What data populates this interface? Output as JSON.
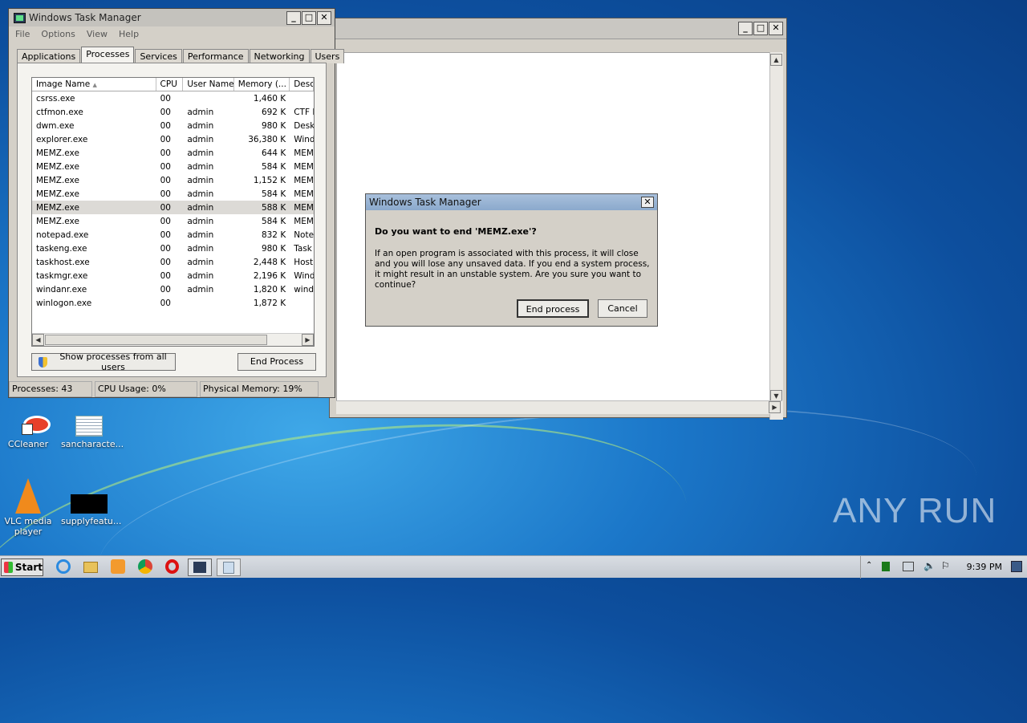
{
  "background_window": {
    "caption_buttons": [
      "_",
      "□",
      "✕"
    ]
  },
  "task_manager": {
    "title": "Windows Task Manager",
    "menu": [
      "File",
      "Options",
      "View",
      "Help"
    ],
    "tabs": [
      "Applications",
      "Processes",
      "Services",
      "Performance",
      "Networking",
      "Users"
    ],
    "active_tab": "Processes",
    "columns": [
      "Image Name",
      "CPU",
      "User Name",
      "Memory (...",
      "Desc"
    ],
    "rows": [
      {
        "name": "csrss.exe",
        "cpu": "00",
        "user": "",
        "mem": "1,460 K",
        "desc": ""
      },
      {
        "name": "ctfmon.exe",
        "cpu": "00",
        "user": "admin",
        "mem": "692 K",
        "desc": "CTF L"
      },
      {
        "name": "dwm.exe",
        "cpu": "00",
        "user": "admin",
        "mem": "980 K",
        "desc": "Desk"
      },
      {
        "name": "explorer.exe",
        "cpu": "00",
        "user": "admin",
        "mem": "36,380 K",
        "desc": "Wind"
      },
      {
        "name": "MEMZ.exe",
        "cpu": "00",
        "user": "admin",
        "mem": "644 K",
        "desc": "MEMZ"
      },
      {
        "name": "MEMZ.exe",
        "cpu": "00",
        "user": "admin",
        "mem": "584 K",
        "desc": "MEMZ"
      },
      {
        "name": "MEMZ.exe",
        "cpu": "00",
        "user": "admin",
        "mem": "1,152 K",
        "desc": "MEMZ"
      },
      {
        "name": "MEMZ.exe",
        "cpu": "00",
        "user": "admin",
        "mem": "584 K",
        "desc": "MEMZ"
      },
      {
        "name": "MEMZ.exe",
        "cpu": "00",
        "user": "admin",
        "mem": "588 K",
        "desc": "MEMZ"
      },
      {
        "name": "MEMZ.exe",
        "cpu": "00",
        "user": "admin",
        "mem": "584 K",
        "desc": "MEMZ"
      },
      {
        "name": "notepad.exe",
        "cpu": "00",
        "user": "admin",
        "mem": "832 K",
        "desc": "Note"
      },
      {
        "name": "taskeng.exe",
        "cpu": "00",
        "user": "admin",
        "mem": "980 K",
        "desc": "Task"
      },
      {
        "name": "taskhost.exe",
        "cpu": "00",
        "user": "admin",
        "mem": "2,448 K",
        "desc": "Host"
      },
      {
        "name": "taskmgr.exe",
        "cpu": "00",
        "user": "admin",
        "mem": "2,196 K",
        "desc": "Wind"
      },
      {
        "name": "windanr.exe",
        "cpu": "00",
        "user": "admin",
        "mem": "1,820 K",
        "desc": "wind"
      },
      {
        "name": "winlogon.exe",
        "cpu": "00",
        "user": "",
        "mem": "1,872 K",
        "desc": ""
      }
    ],
    "selected_row": 8,
    "show_all_label": "Show processes from all users",
    "end_process_label": "End Process",
    "status": {
      "processes": "Processes: 43",
      "cpu": "CPU Usage: 0%",
      "memory": "Physical Memory: 19%"
    }
  },
  "dialog": {
    "title": "Windows Task Manager",
    "question": "Do you want to end 'MEMZ.exe'?",
    "message": "If an open program is associated with this process, it will close and you will lose any unsaved data. If you end a system process, it might result in an unstable system. Are you sure you want to continue?",
    "confirm_label": "End process",
    "cancel_label": "Cancel"
  },
  "desktop_icons": [
    {
      "label": "CCleaner",
      "icon": "ccleaner-icon"
    },
    {
      "label": "sancharacte...",
      "icon": "document-icon"
    },
    {
      "label": "VLC media player",
      "icon": "vlc-icon"
    },
    {
      "label": "supplyfeatu...",
      "icon": "black-file-icon"
    }
  ],
  "taskbar": {
    "start_label": "Start",
    "clock": "9:39 PM",
    "pinned": [
      "ie-icon",
      "explorer-icon",
      "media-player-icon",
      "chrome-icon",
      "opera-icon",
      "task-manager-icon",
      "notepad-icon"
    ]
  },
  "watermark": "ANY RUN",
  "colors": {
    "desktop": "#1b77c9",
    "dialog_title": "#a8c0dc",
    "selection": "#dcdad6"
  }
}
